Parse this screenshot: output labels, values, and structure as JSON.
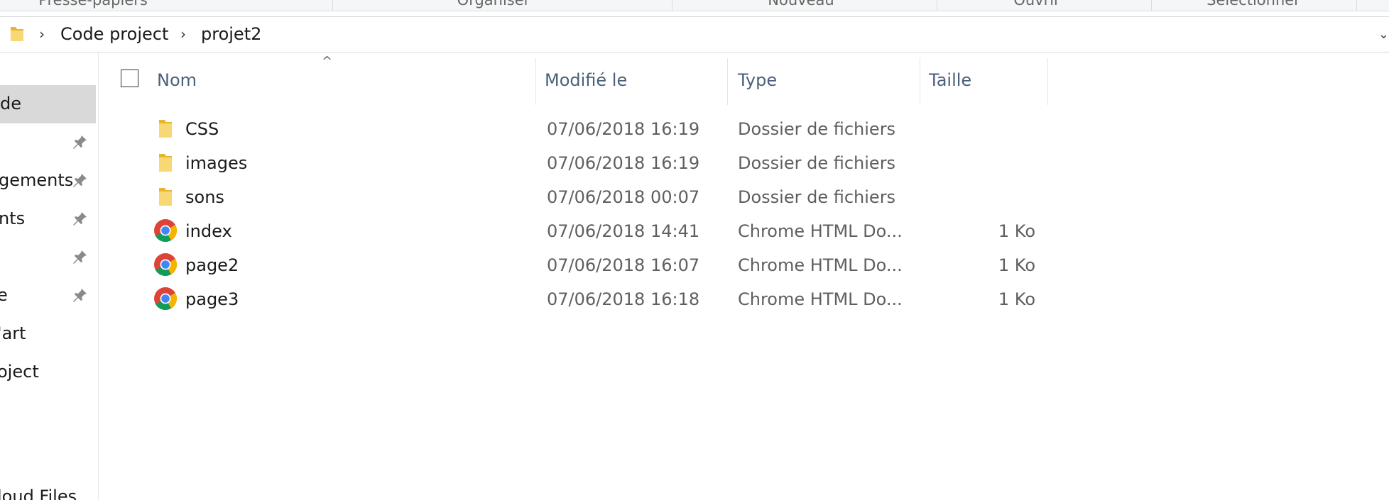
{
  "ribbon": {
    "groups": [
      "Presse-papiers",
      "Organiser",
      "Nouveau",
      "Ouvrir",
      "Sélectionner"
    ]
  },
  "address": {
    "crumbs": [
      "Code project",
      "projet2"
    ]
  },
  "nav": {
    "items": [
      {
        "label": "de",
        "pinned": false,
        "selected": true
      },
      {
        "label": "",
        "pinned": true
      },
      {
        "label": "gements",
        "pinned": true
      },
      {
        "label": "nts",
        "pinned": true
      },
      {
        "label": "",
        "pinned": true
      },
      {
        "label": "e",
        "pinned": true
      },
      {
        "label": "'art",
        "pinned": false
      },
      {
        "label": "oject",
        "pinned": false
      },
      {
        "label": "loud Files",
        "pinned": false
      }
    ]
  },
  "columns": {
    "name": "Nom",
    "modified": "Modifié le",
    "type": "Type",
    "size": "Taille",
    "sort_indicator": "^"
  },
  "files": [
    {
      "name": "CSS",
      "modified": "07/06/2018 16:19",
      "type": "Dossier de fichiers",
      "size": "",
      "icon": "folder-icon"
    },
    {
      "name": "images",
      "modified": "07/06/2018 16:19",
      "type": "Dossier de fichiers",
      "size": "",
      "icon": "folder-icon"
    },
    {
      "name": "sons",
      "modified": "07/06/2018 00:07",
      "type": "Dossier de fichiers",
      "size": "",
      "icon": "folder-icon"
    },
    {
      "name": "index",
      "modified": "07/06/2018 14:41",
      "type": "Chrome HTML Do...",
      "size": "1 Ko",
      "icon": "chrome-icon"
    },
    {
      "name": "page2",
      "modified": "07/06/2018 16:07",
      "type": "Chrome HTML Do...",
      "size": "1 Ko",
      "icon": "chrome-icon"
    },
    {
      "name": "page3",
      "modified": "07/06/2018 16:18",
      "type": "Chrome HTML Do...",
      "size": "1 Ko",
      "icon": "chrome-icon"
    }
  ],
  "colors": {
    "header_text": "#4c607a",
    "selected_nav": "#d9d9d9",
    "folder_yellow": "#f5c842"
  }
}
